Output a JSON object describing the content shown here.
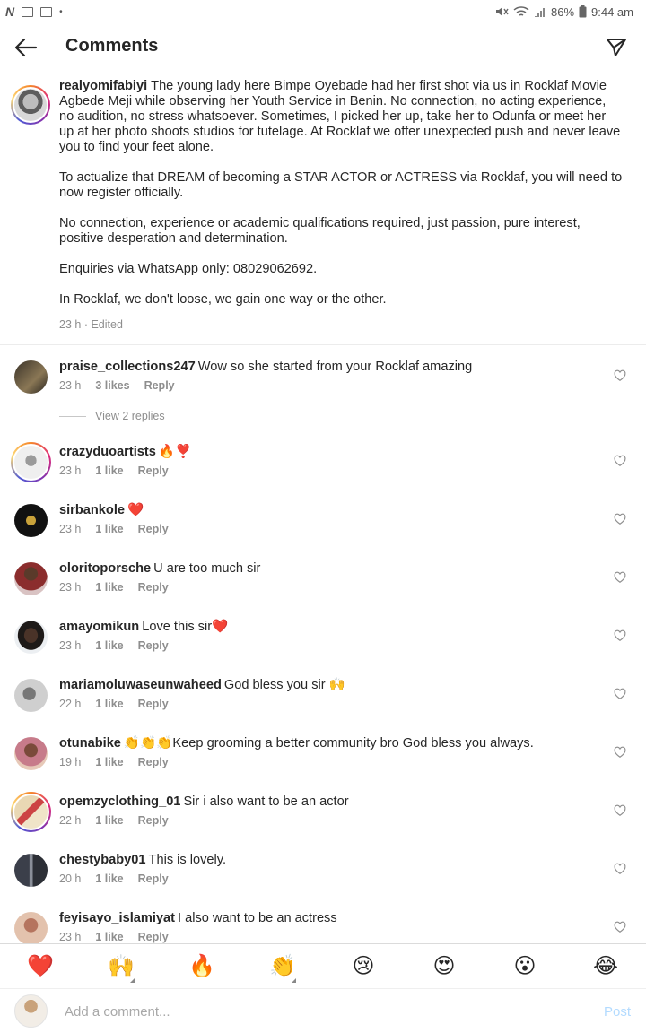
{
  "status_bar": {
    "left_icon_letter": "N",
    "battery": "86%",
    "time": "9:44 am"
  },
  "header": {
    "title": "Comments"
  },
  "caption": {
    "username": "realyomifabiyi",
    "paragraphs": [
      "The young lady here Bimpe Oyebade had her first shot via us in Rocklaf Movie Agbede Meji while observing her Youth Service in Benin. No connection, no acting experience, no audition, no stress whatsoever. Sometimes, I picked her up, take her to Odunfa or meet her up at her photo shoots studios for tutelage. At Rocklaf we offer unexpected push and never leave you to find your feet alone.",
      "To actualize that DREAM of becoming a STAR ACTOR or ACTRESS via Rocklaf, you will need to now register officially.",
      "No connection, experience or academic qualifications required, just passion, pure interest, positive desperation and determination.",
      "Enquiries via WhatsApp only: 08029062692.",
      "In Rocklaf, we don't loose, we gain one way or the other."
    ],
    "time": "23 h",
    "edited": "· Edited"
  },
  "comments": [
    {
      "user": "praise_collections247",
      "text": "Wow so she started from your Rocklaf amazing",
      "time": "23 h",
      "likes": "3 likes",
      "reply": "Reply",
      "avatar_color": "#6b5a3e"
    },
    {
      "user": "crazyduoartists",
      "text": "🔥❣️",
      "time": "23 h",
      "likes": "1 like",
      "reply": "Reply",
      "avatar_color": "#e8e8e8"
    },
    {
      "user": "sirbankole",
      "text": "❤️",
      "time": "23 h",
      "likes": "1 like",
      "reply": "Reply",
      "avatar_color": "#111111"
    },
    {
      "user": "oloritoporsche",
      "text": "U are too much sir",
      "time": "23 h",
      "likes": "1 like",
      "reply": "Reply",
      "avatar_color": "#7a2e2e"
    },
    {
      "user": "amayomikun",
      "text": "Love this sir❤️",
      "time": "23 h",
      "likes": "1 like",
      "reply": "Reply",
      "avatar_color": "#3a2b25"
    },
    {
      "user": "mariamoluwaseunwaheed",
      "text": "God bless you sir 🙌",
      "time": "22 h",
      "likes": "1 like",
      "reply": "Reply",
      "avatar_color": "#9a9a9a"
    },
    {
      "user": "otunabike",
      "text": "👏👏👏Keep grooming a better community bro God bless you always.",
      "time": "19 h",
      "likes": "1 like",
      "reply": "Reply",
      "avatar_color": "#b06a6a"
    },
    {
      "user": "opemzyclothing_01",
      "text": "Sir i also want to be an actor",
      "time": "22 h",
      "likes": "1 like",
      "reply": "Reply",
      "avatar_color": "#d9b87a"
    },
    {
      "user": "chestybaby01",
      "text": "This is lovely.",
      "time": "20 h",
      "likes": "1 like",
      "reply": "Reply",
      "avatar_color": "#4a4f5a"
    },
    {
      "user": "feyisayo_islamiyat",
      "text": "I also want to be an actress",
      "time": "23 h",
      "likes": "1 like",
      "reply": "Reply",
      "avatar_color": "#c98f7a"
    }
  ],
  "view_replies": "View 2 replies",
  "emoji_bar": [
    "❤️",
    "🙌",
    "🔥",
    "👏",
    "😢",
    "😍",
    "😮",
    "😂"
  ],
  "composer": {
    "placeholder": "Add a comment...",
    "post_label": "Post"
  }
}
